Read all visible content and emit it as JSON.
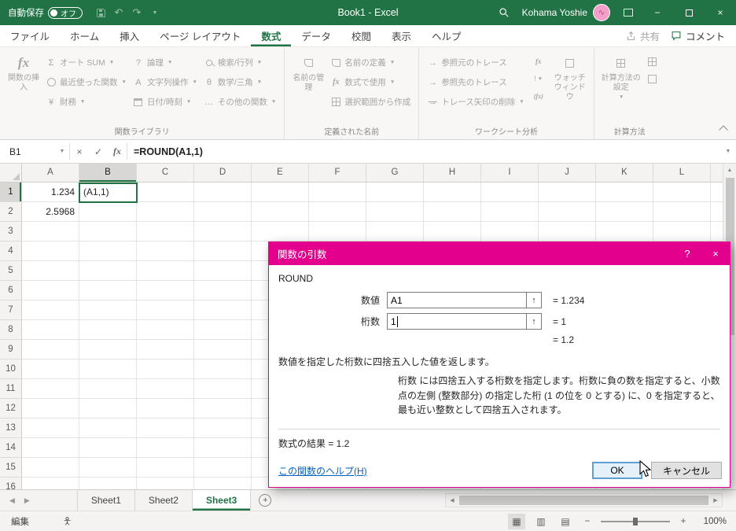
{
  "titlebar": {
    "autosave_label": "自動保存",
    "autosave_state": "オフ",
    "title": "Book1  -  Excel",
    "user_name": "Kohama Yoshie"
  },
  "ribbon": {
    "tabs": [
      "ファイル",
      "ホーム",
      "挿入",
      "ページ レイアウト",
      "数式",
      "データ",
      "校閲",
      "表示",
      "ヘルプ"
    ],
    "share_label": "共有",
    "comments_label": "コメント",
    "function_library": {
      "label": "関数ライブラリ",
      "insert_function": "関数の挿入",
      "autosum": "オート SUM",
      "recent": "最近使った関数",
      "financial": "財務",
      "logical": "論理",
      "text": "文字列操作",
      "datetime": "日付/時刻",
      "lookup": "検索/行列",
      "math": "数学/三角",
      "more": "その他の関数"
    },
    "defined_names": {
      "label": "定義された名前",
      "name_manager": "名前の管理",
      "define_name": "名前の定義",
      "use_in_formula": "数式で使用",
      "create_from_selection": "選択範囲から作成"
    },
    "auditing": {
      "label": "ワークシート分析",
      "trace_precedents": "参照元のトレース",
      "trace_dependents": "参照先のトレース",
      "remove_arrows": "トレース矢印の削除",
      "watch_window": "ウォッチ ウィンドウ"
    },
    "calculation": {
      "label": "計算方法",
      "options": "計算方法の設定"
    }
  },
  "formula_bar": {
    "name_box": "B1",
    "formula": "=ROUND(A1,1)"
  },
  "grid": {
    "columns": [
      "A",
      "B",
      "C",
      "D",
      "E",
      "F",
      "G",
      "H",
      "I",
      "J",
      "K",
      "L"
    ],
    "rows": [
      "1",
      "2",
      "3",
      "4",
      "5",
      "6",
      "7",
      "8",
      "9",
      "10",
      "11",
      "12",
      "13",
      "14",
      "15",
      "16"
    ],
    "selected_column": "B",
    "selected_row": "1",
    "cells": {
      "a1": "1.234",
      "a2": "2.5968",
      "b1_edit": "(A1,1)"
    }
  },
  "dialog": {
    "title": "関数の引数",
    "function_name": "ROUND",
    "args": [
      {
        "label": "数値",
        "value": "A1",
        "result": "=  1.234"
      },
      {
        "label": "桁数",
        "value": "1",
        "result": "=  1"
      }
    ],
    "interim_result": "=  1.2",
    "description": "数値を指定した桁数に四捨五入した値を返します。",
    "arg_description": "桁数  には四捨五入する桁数を指定します。桁数に負の数を指定すると、小数点の左側 (整数部分) の指定した桁 (1 の位を 0 とする) に、0 を指定すると、最も近い整数として四捨五入されます。",
    "result_line": "数式の結果 =  1.2",
    "help_link": "この関数のヘルプ(H)",
    "ok_label": "OK",
    "cancel_label": "キャンセル"
  },
  "sheet_tabs": {
    "tabs": [
      "Sheet1",
      "Sheet2",
      "Sheet3"
    ],
    "active": "Sheet3"
  },
  "status_bar": {
    "mode": "編集",
    "zoom": "100%"
  },
  "icons": {
    "dropdown": "▼",
    "fx": "fx",
    "sigma": "Σ",
    "question": "?",
    "letter_a": "A",
    "theta": "θ",
    "ellipsis": "…",
    "yen": "¥",
    "arrow_right": "→",
    "up_arrow": "↑",
    "check": "✓",
    "close_x": "×",
    "minimize": "−",
    "undo": "↶",
    "redo": "↷",
    "help": "?",
    "plus": "+",
    "minus": "−",
    "tri_left": "◀",
    "tri_right": "▶",
    "tri_up": "▲",
    "tri_down": "▼",
    "view_normal": "▦",
    "view_layout": "▥",
    "view_break": "▤",
    "excl": "!",
    "fx_small": "fx",
    "fx_paren": "(fx)"
  }
}
